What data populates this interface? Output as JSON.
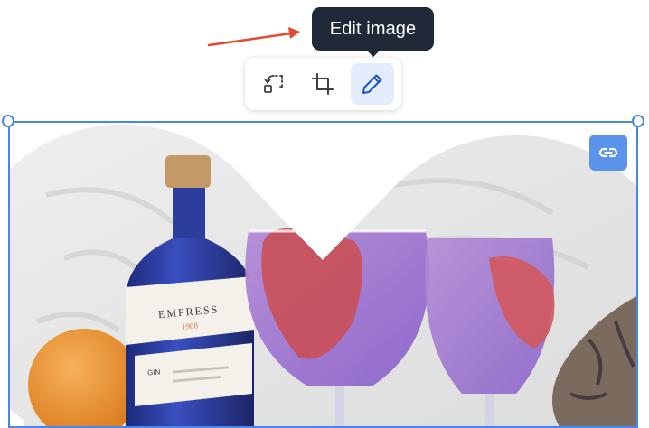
{
  "tooltip": {
    "text": "Edit image"
  },
  "toolbar": {
    "buttons": [
      {
        "icon": "replace-image-icon",
        "active": false
      },
      {
        "icon": "crop-icon",
        "active": false
      },
      {
        "icon": "pencil-icon",
        "active": true
      }
    ]
  },
  "image": {
    "shape": "heart",
    "bottle_label": {
      "brand": "EMPRESS",
      "sub": "1908",
      "type": "GIN"
    }
  },
  "colors": {
    "accent": "#4a86e8",
    "tooltip_bg": "#1f2937",
    "active_button_bg": "#e3ecfc",
    "link_button_bg": "#5b93ea",
    "arrow": "#e8482f"
  }
}
